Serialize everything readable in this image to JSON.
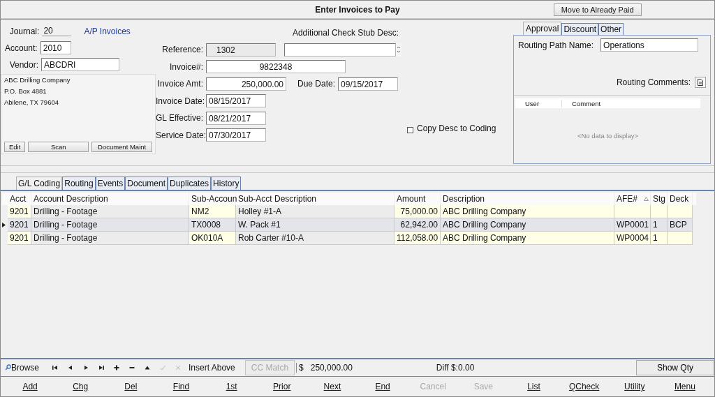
{
  "window": {
    "title": "Enter Invoices to Pay",
    "action_button": "Move to Already Paid"
  },
  "header": {
    "journal_label": "Journal:",
    "journal": "20",
    "journal_name": "A/P Invoices",
    "account_label": "Account:",
    "account": "2010",
    "vendor_label": "Vendor:",
    "vendor": "ABCDRI",
    "address": [
      "ABC Drilling Company",
      "P.O. Box 4881",
      "Abilene, TX  79604"
    ],
    "address_buttons": [
      "Edit",
      "Scan",
      "Document Maint"
    ]
  },
  "invoice": {
    "stub_desc_label": "Additional Check Stub Desc:",
    "reference_label": "Reference:",
    "reference": "1302",
    "invoice_no_label": "Invoice#:",
    "invoice_no": "9822348",
    "amount_label": "Invoice Amt:",
    "amount": "250,000.00",
    "due_date_label": "Due Date:",
    "due_date": "09/15/2017",
    "invoice_date_label": "Invoice Date:",
    "invoice_date": "08/15/2017",
    "gl_effective_label": "GL Effective:",
    "gl_effective": "08/21/2017",
    "service_date_label": "Service Date:",
    "service_date": "07/30/2017",
    "copy_desc": {
      "label": "Copy Desc to Coding",
      "checked": false
    }
  },
  "approval_panel": {
    "tabs": [
      {
        "label": "Approval",
        "selected": true
      },
      {
        "label": "Discount",
        "selected": false
      },
      {
        "label": "Other",
        "selected": false
      }
    ],
    "routing_path_label": "Routing Path Name:",
    "routing_path": "Operations",
    "routing_comments_label": "Routing Comments:",
    "comments_columns": [
      "User",
      "Comment"
    ],
    "empty_text": "<No data to display>"
  },
  "detail_tabs": [
    {
      "label": "G/L Coding",
      "selected": true
    },
    {
      "label": "Routing",
      "selected": false
    },
    {
      "label": "Events",
      "selected": false
    },
    {
      "label": "Document",
      "selected": false
    },
    {
      "label": "Duplicates",
      "selected": false
    },
    {
      "label": "History",
      "selected": false
    }
  ],
  "table": {
    "columns": [
      {
        "label": "Acct",
        "editable": true,
        "sorted": false
      },
      {
        "label": "Account Description",
        "editable": false,
        "sorted": false
      },
      {
        "label": "Sub-Accoun",
        "editable": true,
        "sorted": false
      },
      {
        "label": "Sub-Acct Description",
        "editable": false,
        "sorted": false
      },
      {
        "label": "Amount",
        "editable": true,
        "sorted": false
      },
      {
        "label": "Description",
        "editable": true,
        "sorted": false
      },
      {
        "label": "AFE#",
        "editable": true,
        "sorted": true
      },
      {
        "label": "Stg",
        "editable": true,
        "sorted": false
      },
      {
        "label": "Deck",
        "editable": true,
        "sorted": false
      }
    ],
    "rows": [
      {
        "selected": false,
        "cells": [
          "9201",
          "Drilling - Footage",
          "NM2",
          "Holley #1-A",
          "75,000.00",
          "ABC Drilling Company",
          "",
          "",
          ""
        ]
      },
      {
        "selected": true,
        "cells": [
          "9201",
          "Drilling - Footage",
          "TX0008",
          "W. Pack #1",
          "62,942.00",
          "ABC Drilling Company",
          "WP0001",
          "1",
          "BCP"
        ]
      },
      {
        "selected": false,
        "cells": [
          "9201",
          "Drilling - Footage",
          "OK010A",
          "Rob Carter #10-A",
          "112,058.00",
          "ABC Drilling Company",
          "WP0004",
          "1",
          ""
        ]
      }
    ]
  },
  "nav_bar": {
    "mode": "Browse",
    "icons": [
      {
        "kind": "first",
        "disabled": false
      },
      {
        "kind": "prev",
        "disabled": false
      },
      {
        "kind": "next",
        "disabled": false
      },
      {
        "kind": "last",
        "disabled": false
      },
      {
        "kind": "add",
        "disabled": false
      },
      {
        "kind": "remove",
        "disabled": false
      },
      {
        "kind": "up",
        "disabled": false
      },
      {
        "kind": "confirm",
        "disabled": true
      },
      {
        "kind": "cancel",
        "disabled": true
      }
    ],
    "insert_above": "Insert Above",
    "cc_match": {
      "label": "CC Match",
      "disabled": true
    },
    "currency": "$",
    "total": "250,000.00",
    "diff": "Diff $:0.00",
    "show_qty": "Show Qty"
  },
  "buttons": [
    {
      "label": "Add",
      "disabled": false
    },
    {
      "label": "Chg",
      "disabled": false
    },
    {
      "label": "Del",
      "disabled": false
    },
    {
      "label": "Find",
      "disabled": false
    },
    {
      "label": "1st",
      "disabled": false
    },
    {
      "label": "Prior",
      "disabled": false
    },
    {
      "label": "Next",
      "disabled": false
    },
    {
      "label": "End",
      "disabled": false
    },
    {
      "label": "Cancel",
      "disabled": true
    },
    {
      "label": "Save",
      "disabled": true
    },
    {
      "label": "List",
      "disabled": false
    },
    {
      "label": "QCheck",
      "disabled": false
    },
    {
      "label": "Utility",
      "disabled": false
    },
    {
      "label": "Menu",
      "disabled": false
    }
  ]
}
